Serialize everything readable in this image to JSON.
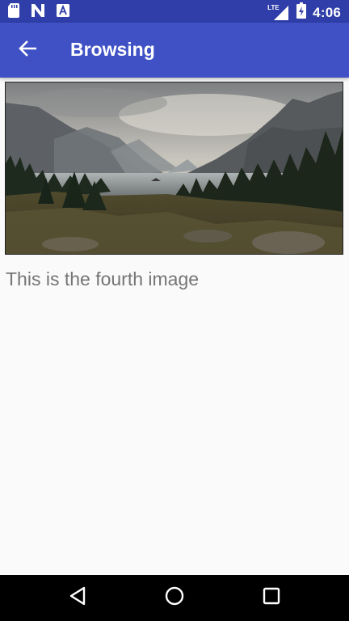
{
  "status_bar": {
    "icons": [
      "sd-card-icon",
      "n-notification-icon",
      "a-notification-icon",
      "lte-signal-icon",
      "battery-icon"
    ],
    "network_label": "LTE",
    "time": "4:06"
  },
  "app_bar": {
    "title": "Browsing",
    "back_icon": "arrow-back-icon"
  },
  "content": {
    "image_alt": "mountain-lake-landscape",
    "caption": "This is the fourth image"
  },
  "nav_bar": {
    "buttons": [
      "back-triangle-icon",
      "home-circle-icon",
      "recents-square-icon"
    ]
  },
  "colors": {
    "status_bar": "#2f3ea8",
    "app_bar": "#3f51c5",
    "background": "#fafafa",
    "caption_text": "#757575"
  }
}
